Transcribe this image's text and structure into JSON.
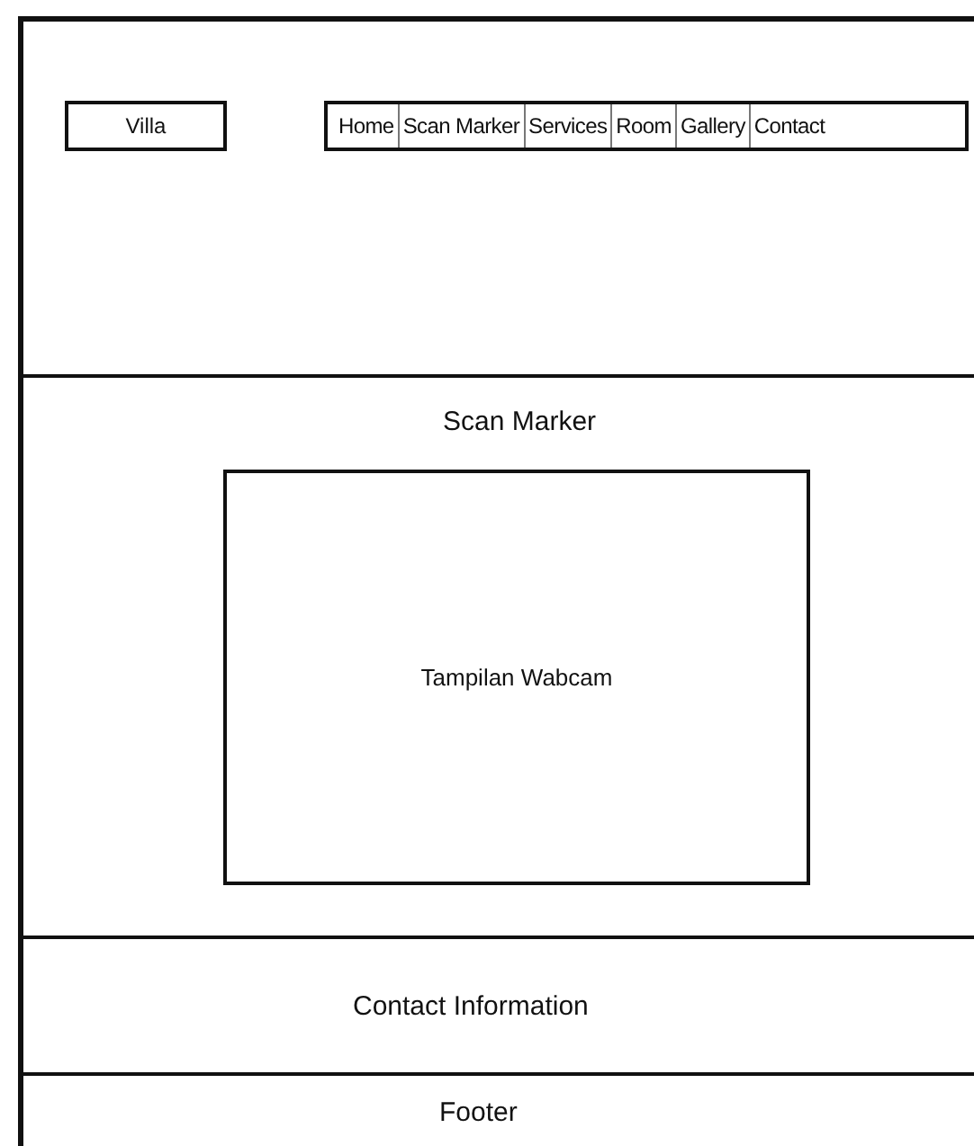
{
  "logo": "Villa",
  "nav": [
    {
      "label": "Home"
    },
    {
      "label": "Scan Marker"
    },
    {
      "label": "Services"
    },
    {
      "label": "Room"
    },
    {
      "label": "Gallery"
    },
    {
      "label": "Contact"
    }
  ],
  "main": {
    "title": "Scan Marker",
    "webcam_label": "Tampilan Wabcam"
  },
  "contact": "Contact Information",
  "footer": "Footer"
}
